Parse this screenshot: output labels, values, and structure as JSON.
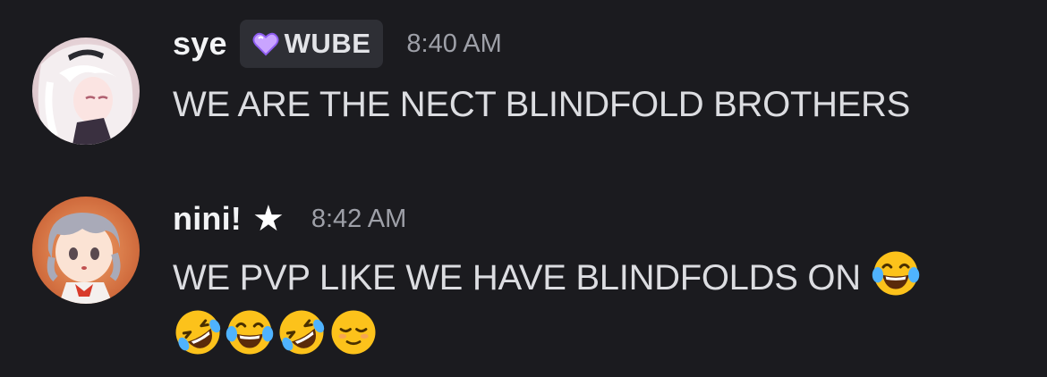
{
  "messages": [
    {
      "username": "sye",
      "role_tag": {
        "label": "WUBE",
        "icon": "heart-icon",
        "icon_color": "#c9a4ff"
      },
      "timestamp": "8:40 AM",
      "text": "WE ARE THE NECT BLINDFOLD BROTHERS",
      "avatar": "anime-avatar-white-hair"
    },
    {
      "username": "nini!",
      "badge": "★",
      "timestamp": "8:42 AM",
      "text": "WE PVP LIKE WE HAVE BLINDFOLDS ON",
      "emojis_inline": [
        "face-with-tears-of-joy"
      ],
      "emojis_line": [
        "rolling-on-floor-laughing",
        "face-with-tears-of-joy",
        "rolling-on-floor-laughing",
        "relieved-face"
      ],
      "avatar": "anime-avatar-grey-hair"
    }
  ],
  "colors": {
    "background": "#1b1b1f",
    "username": "#f2f3f5",
    "message_text": "#dcdde1",
    "timestamp": "#9ea0a8",
    "tag_background": "#2e2f35"
  }
}
